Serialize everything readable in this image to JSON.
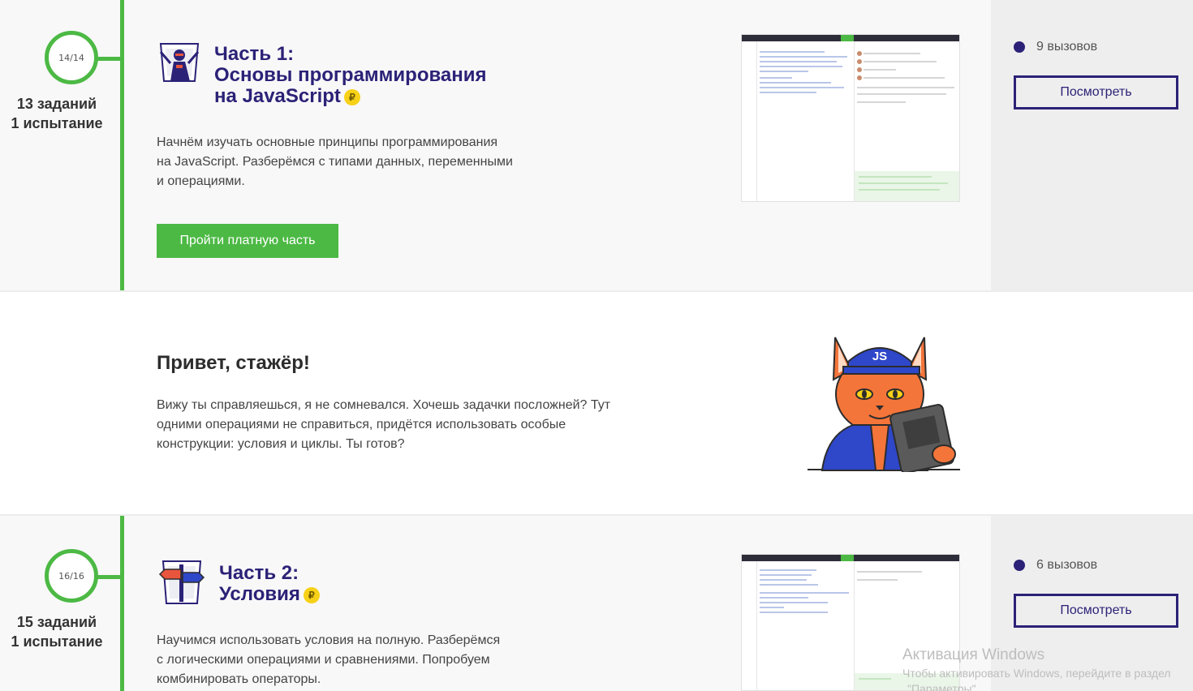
{
  "part1": {
    "progress": "14/14",
    "tasks_count": "13 заданий",
    "trials_count": "1 испытание",
    "title_line1": "Часть 1:",
    "title_line2": "Основы программирования",
    "title_line3": "на JavaScript",
    "currency_badge": "₽",
    "description_line1": "Начнём изучать основные принципы программирования",
    "description_line2": "на JavaScript. Разберёмся с типами данных, переменными",
    "description_line3": "и операциями.",
    "cta_label": "Пройти платную часть",
    "calls_count": "9 вызовов",
    "view_label": "Посмотреть",
    "icon": "ninja-icon"
  },
  "greeting": {
    "title": "Привет, стажёр!",
    "text_line1": "Вижу ты справляешься, я не сомневался. Хочешь задачки посложней? Тут",
    "text_line2": "одними операциями не справиться, придётся использовать особые",
    "text_line3": "конструкции: условия и циклы. Ты готов?",
    "mascot_badge": "JS"
  },
  "part2": {
    "progress": "16/16",
    "tasks_count": "15 заданий",
    "trials_count": "1 испытание",
    "title_line1": "Часть 2:",
    "title_line2": "Условия",
    "currency_badge": "₽",
    "description_line1": "Научимся использовать условия на полную. Разберёмся",
    "description_line2": "с логическими операциями и сравнениями. Попробуем",
    "description_line3": "комбинировать операторы.",
    "calls_count": "6 вызовов",
    "view_label": "Посмотреть",
    "icon": "signpost-icon"
  },
  "watermark": {
    "title": "Активация Windows",
    "line1": "Чтобы активировать Windows, перейдите в раздел",
    "line2": "\"Параметры\"."
  },
  "colors": {
    "accent_green": "#4cb944",
    "brand_purple": "#2b2277",
    "ruble_yellow": "#f7d117"
  }
}
